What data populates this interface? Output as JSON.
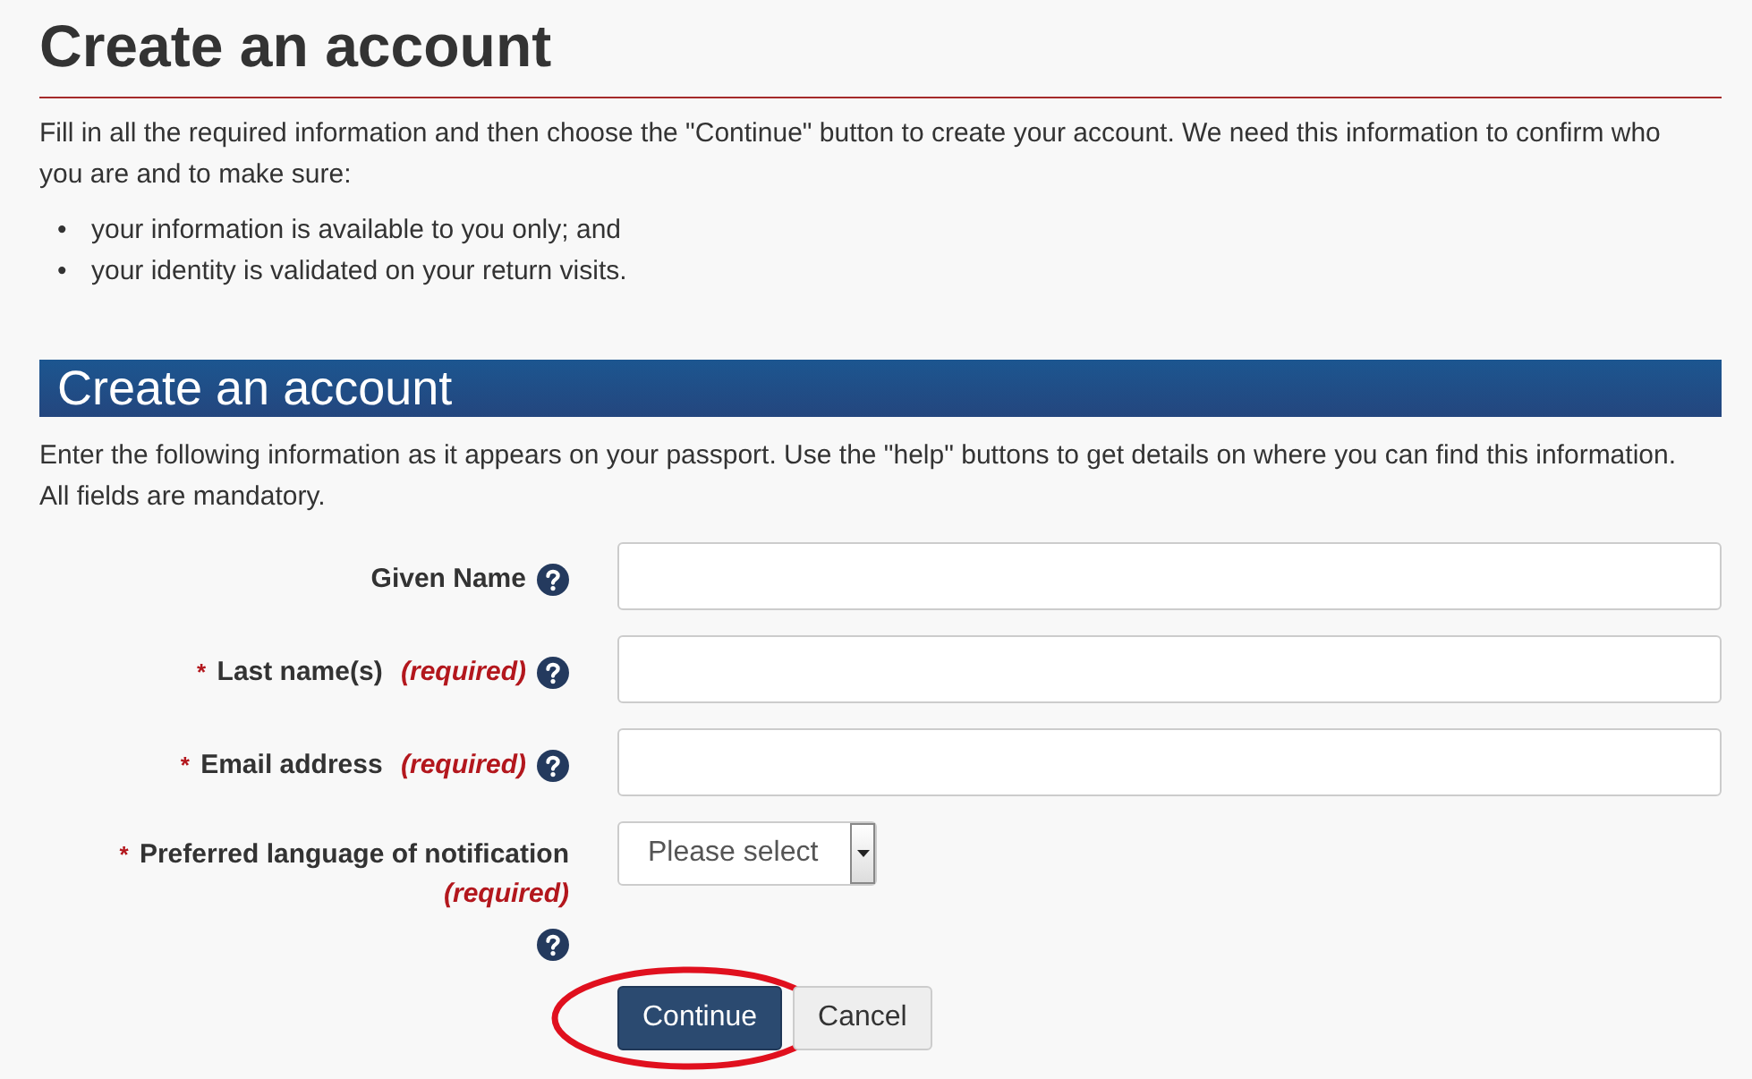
{
  "title": "Create an account",
  "intro": "Fill in all the required information and then choose the \"Continue\" button to create your account. We need this information to confirm who you are and to make sure:",
  "bullets": [
    {
      "marker": "•",
      "text": "your information is available to you only; and"
    },
    {
      "marker": "•",
      "text": "your identity is validated on your return visits."
    }
  ],
  "section": {
    "title": "Create an account",
    "instructions": "Enter the following information as it appears on your passport. Use the \"help\" buttons to get details on where you can find this information. All fields are mandatory."
  },
  "fields": [
    {
      "kind": "text",
      "label": "Given Name"
    },
    {
      "kind": "text",
      "mark": "*",
      "label": "Last name(s)",
      "note": "(required)"
    },
    {
      "kind": "text",
      "mark": "*",
      "label": "Email address",
      "note": "(required)"
    },
    {
      "kind": "select",
      "mark": "*",
      "label": "Preferred language of notification",
      "note": "(required)",
      "placeholder": "Please select"
    }
  ],
  "buttons": [
    {
      "kind": "primary",
      "label": "Continue",
      "circled": true
    },
    {
      "kind": "secondary",
      "label": "Cancel",
      "circled": false
    }
  ]
}
